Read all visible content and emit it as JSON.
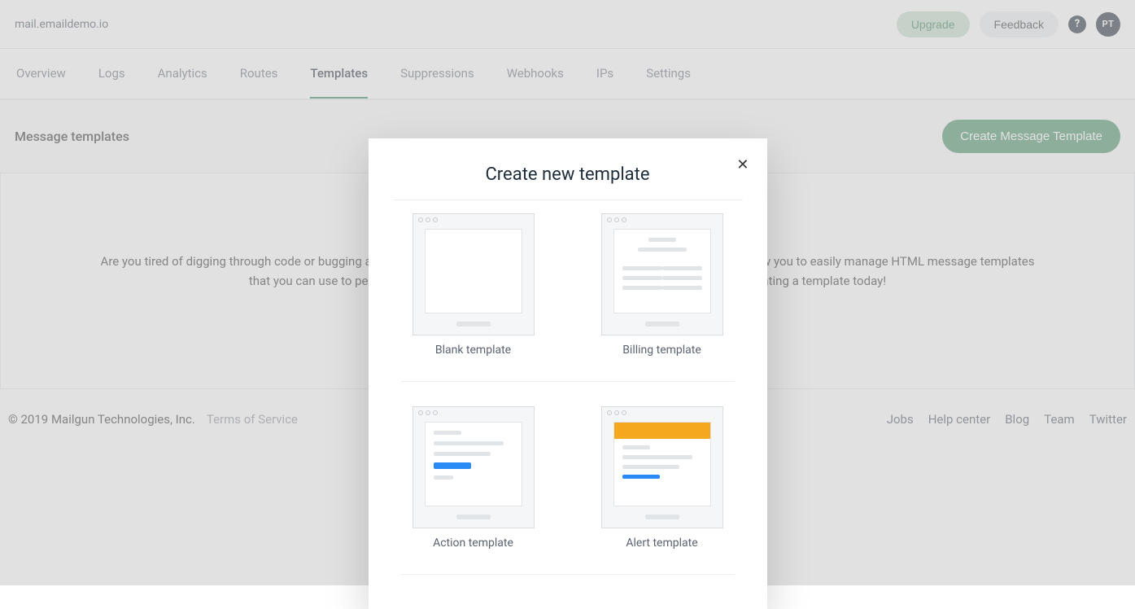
{
  "header": {
    "domain_label": "mail.emaildemo.io",
    "upgrade": "Upgrade",
    "feedback": "Feedback",
    "help": "?",
    "avatar": "PT"
  },
  "nav": {
    "tabs": [
      "Overview",
      "Logs",
      "Analytics",
      "Routes",
      "Templates",
      "Suppressions",
      "Webhooks",
      "IPs",
      "Settings"
    ],
    "active_index": 4
  },
  "section": {
    "title": "Message templates",
    "cta": "Create Message Template"
  },
  "empty": {
    "line1": "Are you tired of digging through code or bugging a developer just to update some copy in an email? Mailgun templates allow you to easily manage HTML message templates",
    "line2": "that you can use to personalize each message sent through the Mailgun API. Get started by creating a template today!"
  },
  "footer": {
    "copyright": "© 2019 Mailgun Technologies, Inc.",
    "tos": "Terms of Service",
    "links": [
      "Jobs",
      "Help center",
      "Blog",
      "Team",
      "Twitter"
    ]
  },
  "modal": {
    "title": "Create new template",
    "options": [
      "Blank template",
      "Billing template",
      "Action template",
      "Alert template"
    ]
  }
}
